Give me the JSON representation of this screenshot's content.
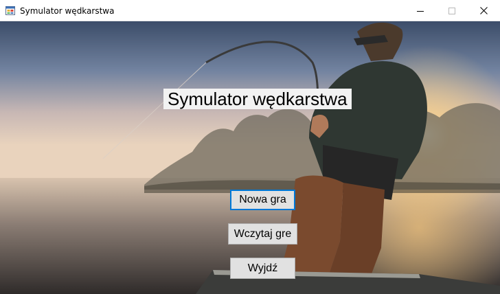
{
  "window": {
    "title": "Symulator wędkarstwa",
    "app_icon": "windows-forms-app-icon",
    "controls": {
      "minimize_icon": "minimize-icon",
      "maximize_icon": "maximize-icon",
      "close_icon": "close-icon"
    }
  },
  "main": {
    "heading": "Symulator wędkarstwa",
    "background": "fisherman-lake-sunset-photo",
    "buttons": {
      "new_game": "Nowa gra",
      "load_game": "Wczytaj gre",
      "exit": "Wyjdź"
    }
  },
  "colors": {
    "focus_border": "#0078d7",
    "button_face": "#e1e1e1",
    "label_background": "#f2f2f2"
  }
}
